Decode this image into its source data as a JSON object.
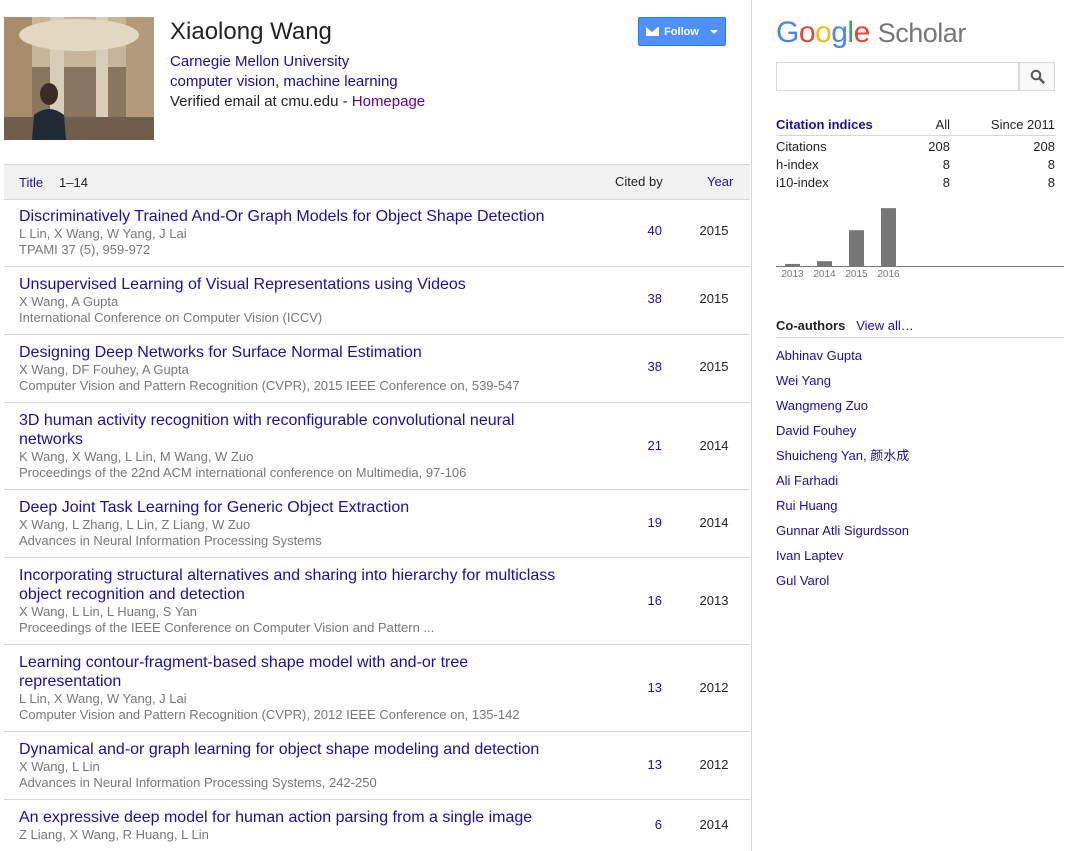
{
  "profile": {
    "name": "Xiaolong Wang",
    "affiliation": "Carnegie Mellon University",
    "interests": [
      "computer vision",
      "machine learning"
    ],
    "interest_sep": ", ",
    "email_text": "Verified email at cmu.edu - ",
    "homepage": "Homepage",
    "follow_label": "Follow"
  },
  "table_header": {
    "title": "Title",
    "range": "1–14",
    "cited_by": "Cited by",
    "year": "Year"
  },
  "papers": [
    {
      "title": "Discriminatively Trained And-Or Graph Models for Object Shape Detection",
      "authors": "L Lin, X Wang, W Yang, J Lai",
      "venue": "TPAMI 37 (5), 959-972",
      "cited": "40",
      "year": "2015"
    },
    {
      "title": "Unsupervised Learning of Visual Representations using Videos",
      "authors": "X Wang, A Gupta",
      "venue": "International Conference on Computer Vision (ICCV)",
      "cited": "38",
      "year": "2015"
    },
    {
      "title": "Designing Deep Networks for Surface Normal Estimation",
      "authors": "X Wang, DF Fouhey, A Gupta",
      "venue": "Computer Vision and Pattern Recognition (CVPR), 2015 IEEE Conference on, 539-547",
      "cited": "38",
      "year": "2015"
    },
    {
      "title": "3D human activity recognition with reconfigurable convolutional neural networks",
      "authors": "K Wang, X Wang, L Lin, M Wang, W Zuo",
      "venue": "Proceedings of the 22nd ACM international conference on Multimedia, 97-106",
      "cited": "21",
      "year": "2014"
    },
    {
      "title": "Deep Joint Task Learning for Generic Object Extraction",
      "authors": "X Wang, L Zhang, L Lin, Z Liang, W Zuo",
      "venue": "Advances in Neural Information Processing Systems",
      "cited": "19",
      "year": "2014"
    },
    {
      "title": "Incorporating structural alternatives and sharing into hierarchy for multiclass object recognition and detection",
      "authors": "X Wang, L Lin, L Huang, S Yan",
      "venue": "Proceedings of the IEEE Conference on Computer Vision and Pattern ...",
      "cited": "16",
      "year": "2013"
    },
    {
      "title": "Learning contour-fragment-based shape model with and-or tree representation",
      "authors": "L Lin, X Wang, W Yang, J Lai",
      "venue": "Computer Vision and Pattern Recognition (CVPR), 2012 IEEE Conference on, 135-142",
      "cited": "13",
      "year": "2012"
    },
    {
      "title": "Dynamical and-or graph learning for object shape modeling and detection",
      "authors": "X Wang, L Lin",
      "venue": "Advances in Neural Information Processing Systems, 242-250",
      "cited": "13",
      "year": "2012"
    },
    {
      "title": "An expressive deep model for human action parsing from a single image",
      "authors": "Z Liang, X Wang, R Huang, L Lin",
      "venue": "",
      "cited": "6",
      "year": "2014"
    }
  ],
  "scholar": {
    "logo_google": [
      "G",
      "o",
      "o",
      "g",
      "l",
      "e"
    ],
    "logo_scholar": "Scholar",
    "search_placeholder": ""
  },
  "citation_indices": {
    "title": "Citation indices",
    "col_all": "All",
    "col_since": "Since 2011",
    "rows": [
      {
        "label": "Citations",
        "all": "208",
        "since": "208"
      },
      {
        "label": "h-index",
        "all": "8",
        "since": "8"
      },
      {
        "label": "i10-index",
        "all": "8",
        "since": "8"
      }
    ]
  },
  "chart_data": {
    "type": "bar",
    "categories": [
      "2013",
      "2014",
      "2015",
      "2016"
    ],
    "values": [
      3,
      7,
      52,
      84
    ],
    "ylim": [
      0,
      90
    ],
    "bar_color": "#777777"
  },
  "coauthors": {
    "title": "Co-authors",
    "view_all": "View all…",
    "names": [
      "Abhinav Gupta",
      "Wei Yang",
      "Wangmeng Zuo",
      "David Fouhey",
      "Shuicheng Yan, 颜水成",
      "Ali Farhadi",
      "Rui Huang",
      "Gunnar Atli Sigurdsson",
      "Ivan Laptev",
      "Gul Varol"
    ]
  }
}
